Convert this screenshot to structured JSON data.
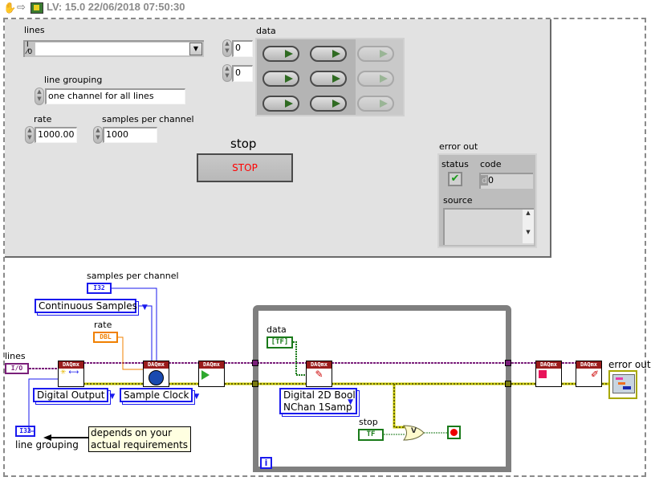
{
  "toolbar": {
    "icons": [
      "hand-icon",
      "arrow-right-icon",
      "vi-icon"
    ],
    "title": "LV: 15.0 22/06/2018 07:50:30"
  },
  "front_panel": {
    "lines": {
      "label": "lines",
      "prefix": "I/O",
      "value": ""
    },
    "line_grouping": {
      "label": "line grouping",
      "value": "one channel for all lines"
    },
    "rate": {
      "label": "rate",
      "value": "1000.00"
    },
    "samples_per_channel": {
      "label": "samples per channel",
      "value": "1000"
    },
    "data": {
      "label": "data",
      "row_index": "0",
      "col_index": "0",
      "leds": [
        [
          false,
          false,
          false
        ],
        [
          false,
          false,
          false
        ],
        [
          false,
          false,
          false
        ]
      ],
      "enabled_columns": 2
    },
    "stop": {
      "label": "stop",
      "button_text": "STOP"
    },
    "error_out": {
      "label": "error out",
      "status_label": "status",
      "status_ok": true,
      "code_label": "code",
      "code_prefix": "d",
      "code_value": "0",
      "source_label": "source",
      "source_value": ""
    }
  },
  "block_diagram": {
    "samples_per_channel": {
      "label": "samples per channel",
      "type": "I32"
    },
    "sample_mode": {
      "value": "Continuous Samples"
    },
    "rate": {
      "label": "rate",
      "type": "DBL"
    },
    "lines": {
      "label": "lines",
      "type": "I/O"
    },
    "line_grouping": {
      "label": "line grouping",
      "type": "I32"
    },
    "create_channel": {
      "header": "DAQmx",
      "polymorphic": "Digital Output"
    },
    "timing": {
      "header": "DAQmx",
      "polymorphic": "Sample Clock"
    },
    "start_task": {
      "header": "DAQmx"
    },
    "write": {
      "header": "DAQmx",
      "polymorphic_line1": "Digital 2D Bool",
      "polymorphic_line2": "NChan 1Samp"
    },
    "stop_task": {
      "header": "DAQmx"
    },
    "clear_task": {
      "header": "DAQmx"
    },
    "data": {
      "label": "data",
      "type": "[TF]"
    },
    "stop": {
      "label": "stop",
      "type": "TF"
    },
    "or_gate": {
      "symbol": "V"
    },
    "loop_iteration": {
      "symbol": "i"
    },
    "error_out": {
      "label": "error out"
    },
    "comment": "depends on your actual requirements",
    "wire_colors": {
      "io": "#7a1f7a",
      "error": "#c8c800",
      "integer": "#1a1aee",
      "double": "#f08000",
      "boolean": "#1a7a1a"
    }
  }
}
